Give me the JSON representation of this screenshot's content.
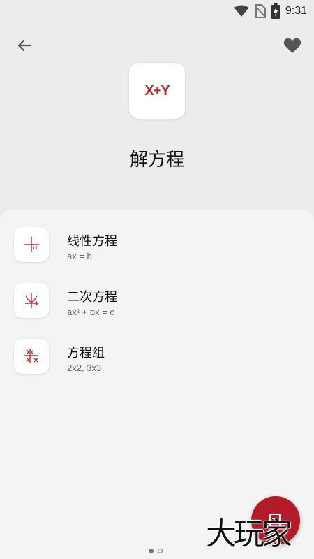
{
  "status_bar": {
    "time": "9:31",
    "icons": [
      "wifi-icon",
      "no-sim-icon",
      "battery-charging-icon"
    ]
  },
  "header": {
    "back_icon": "arrow-left-icon",
    "favorite_icon": "heart-icon",
    "logo_text": "X+Y",
    "title": "解方程"
  },
  "items": [
    {
      "title": "线性方程",
      "subtitle": "ax = b",
      "icon": "linear-graph-icon"
    },
    {
      "title": "二次方程",
      "subtitle": "ax² + bx = c",
      "icon": "parabola-icon"
    },
    {
      "title": "方程组",
      "subtitle": "2x2, 3x3",
      "icon": "system-arrows-icon"
    }
  ],
  "fab": {
    "icon": "notes-icon"
  },
  "watermark": "大玩家",
  "pager": {
    "count": 2,
    "active": 0
  },
  "colors": {
    "accent": "#c9202a",
    "fab": "#b31b28",
    "background": "#ececec",
    "sheet": "#f4f4f4"
  }
}
